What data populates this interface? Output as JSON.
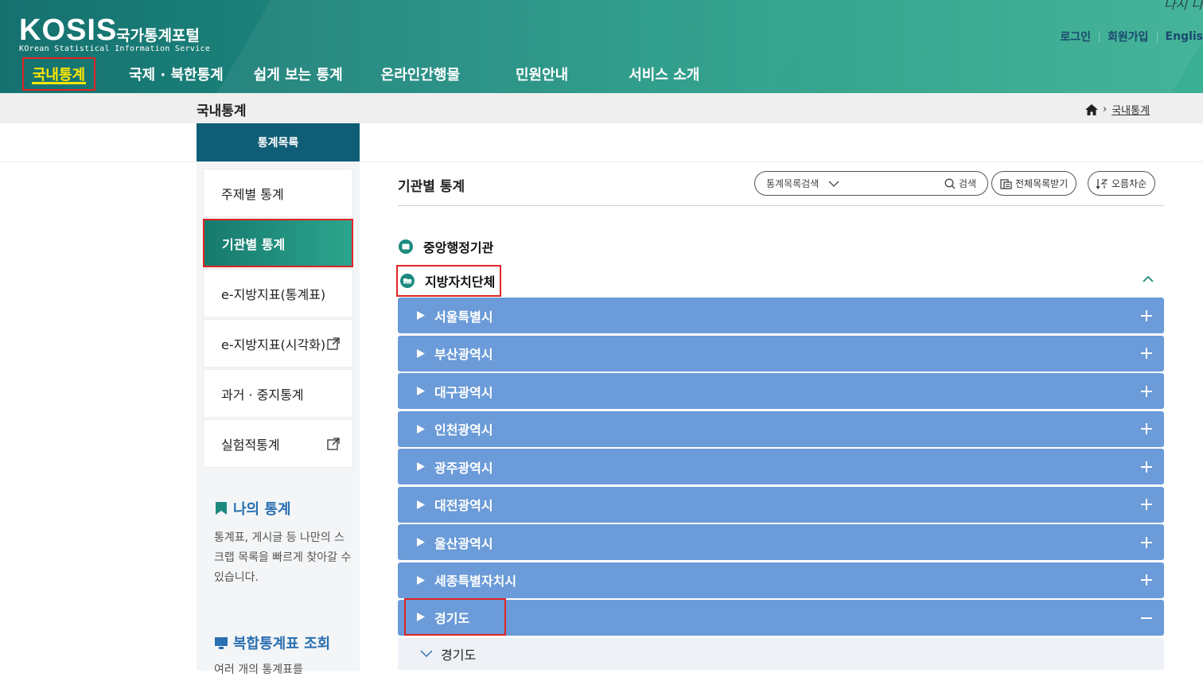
{
  "header": {
    "logo_main": "KOSIS",
    "logo_kr": "국가통계포털",
    "logo_sub": "KOrean Statistical Information Service",
    "corner_text": "나시 나",
    "util": {
      "login": "로그인",
      "signup": "회원가입",
      "english": "Englis"
    },
    "nav": [
      "국내통계",
      "국제 · 북한통계",
      "쉽게 보는 통계",
      "온라인간행물",
      "민원안내",
      "서비스 소개"
    ]
  },
  "crumb": {
    "title": "국내통계",
    "current": "국내통계"
  },
  "sidebar": {
    "heading": "통계목록",
    "items": [
      {
        "label": "주제별 통계"
      },
      {
        "label": "기관별 통계"
      },
      {
        "label": "e-지방지표(통계표)"
      },
      {
        "label": "e-지방지표(시각화)"
      },
      {
        "label": "과거 · 중지통계"
      },
      {
        "label": "실험적통계"
      }
    ],
    "mystat": {
      "title": "나의 통계",
      "desc": "통계표, 게시글 등 나만의 스크랩 목록을 빠르게 찾아갈 수 있습니다."
    },
    "combo": {
      "title": "복합통계표 조회",
      "desc": "여러 개의 통계표를"
    }
  },
  "main": {
    "title": "기관별 통계",
    "search": {
      "select_label": "통계목록검색",
      "button_label": "검색"
    },
    "download_label": "전체목록받기",
    "sort_label": "오름차순",
    "orgs": {
      "central": "중앙행정기관",
      "local": "지방자치단체"
    },
    "regions": [
      "서울특별시",
      "부산광역시",
      "대구광역시",
      "인천광역시",
      "광주광역시",
      "대전광역시",
      "울산광역시",
      "세종특별자치시",
      "경기도"
    ],
    "expanded_sub": "경기도"
  },
  "colors": {
    "accordion": "#6b9bd8",
    "header_start": "#15716f",
    "header_end": "#3bb095",
    "highlight": "#e02424",
    "nav_active": "#ffe600"
  }
}
